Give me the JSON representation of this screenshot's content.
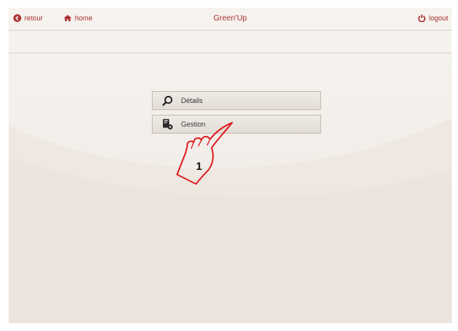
{
  "header": {
    "back_label": "retour",
    "home_label": "home",
    "title": "Green'Up",
    "logout_label": "logout"
  },
  "menu": {
    "items": [
      {
        "label": "Détails",
        "icon": "magnifier-icon"
      },
      {
        "label": "Gestion",
        "icon": "document-settings-icon"
      }
    ]
  },
  "annotation": {
    "step_number": "1"
  },
  "colors": {
    "accent": "#a83232",
    "button_border": "#c7beb5",
    "annotation_red": "#e0161b"
  }
}
